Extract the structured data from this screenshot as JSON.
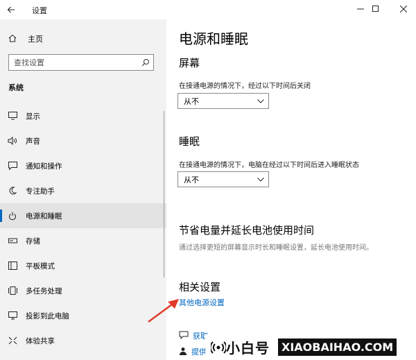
{
  "window": {
    "title": "设置"
  },
  "sidebar": {
    "home_label": "主页",
    "search_placeholder": "查找设置",
    "section_label": "系统",
    "items": [
      {
        "label": "显示",
        "icon": "monitor-icon"
      },
      {
        "label": "声音",
        "icon": "speaker-icon"
      },
      {
        "label": "通知和操作",
        "icon": "notification-icon"
      },
      {
        "label": "专注助手",
        "icon": "moon-icon"
      },
      {
        "label": "电源和睡眠",
        "icon": "power-icon",
        "active": true
      },
      {
        "label": "存储",
        "icon": "storage-icon"
      },
      {
        "label": "平板模式",
        "icon": "tablet-icon"
      },
      {
        "label": "多任务处理",
        "icon": "multitask-icon"
      },
      {
        "label": "投影到此电脑",
        "icon": "projection-icon"
      },
      {
        "label": "体验共享",
        "icon": "share-icon"
      }
    ]
  },
  "main": {
    "title": "电源和睡眠",
    "screen": {
      "heading": "屏幕",
      "description": "在接通电源的情况下，经过以下时间后关闭",
      "value": "从不"
    },
    "sleep": {
      "heading": "睡眠",
      "description": "在接通电源的情况下，电脑在经过以下时间后进入睡眠状态",
      "value": "从不"
    },
    "battery": {
      "heading": "节省电量并延长电池使用时间",
      "description": "通过选择更短的屏幕显示时长和睡眠设置，延长电池使用时间。"
    },
    "related": {
      "heading": "相关设置",
      "link": "其他电源设置",
      "items": [
        {
          "label": "获取",
          "icon": "help-icon"
        },
        {
          "label": "提供",
          "icon": "feedback-icon"
        }
      ]
    }
  },
  "watermark": {
    "brand": "小白号",
    "url": "XIAOBAIHAO.COM"
  },
  "colors": {
    "accent": "#0067c0",
    "sidebar_bg": "#f2f2f2",
    "arrow": "#e03a2a"
  }
}
